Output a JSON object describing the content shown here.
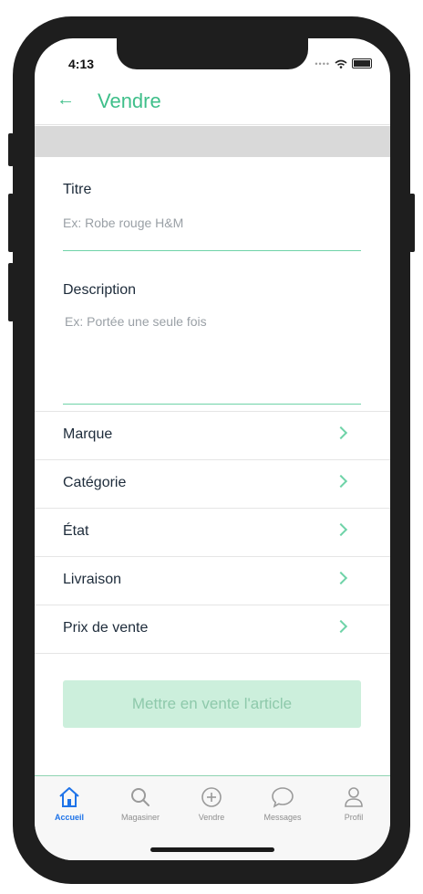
{
  "status_bar": {
    "time": "4:13"
  },
  "header": {
    "title": "Vendre"
  },
  "form": {
    "title_label": "Titre",
    "title_placeholder": "Ex: Robe rouge H&M",
    "description_label": "Description",
    "description_placeholder": "Ex: Portée une seule fois"
  },
  "options": [
    {
      "label": "Marque"
    },
    {
      "label": "Catégorie"
    },
    {
      "label": "État"
    },
    {
      "label": "Livraison"
    },
    {
      "label": "Prix de vente"
    }
  ],
  "submit_label": "Mettre en vente l'article",
  "tabs": [
    {
      "label": "Accueil",
      "icon": "home-icon",
      "active": true
    },
    {
      "label": "Magasiner",
      "icon": "search-icon"
    },
    {
      "label": "Vendre",
      "icon": "plus-circle-icon"
    },
    {
      "label": "Messages",
      "icon": "chat-bubble-icon"
    },
    {
      "label": "Profil",
      "icon": "person-icon"
    }
  ],
  "colors": {
    "accent": "#3fbf8a",
    "underline": "#6fd3a8",
    "cta_bg": "#ccefdc",
    "active_tab": "#1e73e8"
  }
}
